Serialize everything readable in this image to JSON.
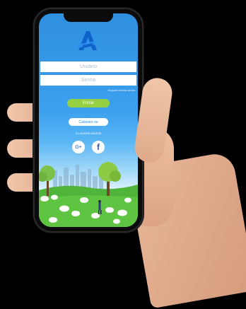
{
  "login": {
    "username_placeholder": "Usuário",
    "password_placeholder": "Senha",
    "forgot_label": "Esqueci minha senha",
    "enter_label": "Entrar",
    "register_label": "Cadastre-se",
    "or_access_label": "ou acesse usando",
    "google_label": "G+",
    "facebook_label": "f"
  },
  "icons": [
    "app-logo-icon",
    "google-plus-icon",
    "facebook-icon"
  ],
  "colors": {
    "screen_blue": "#2f8fe0",
    "enter_green": "#94d041",
    "grass_green": "#4fb43a",
    "facebook_blue": "#3b5ba6"
  }
}
